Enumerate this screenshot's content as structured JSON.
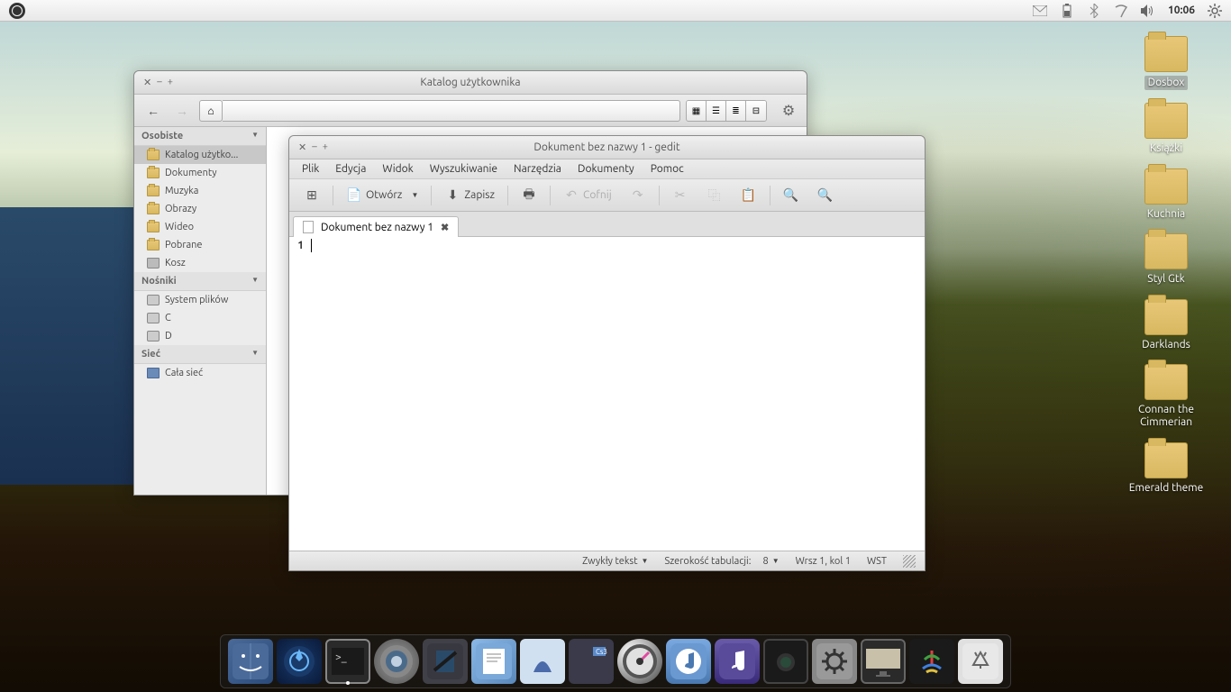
{
  "panel": {
    "time": "10:06"
  },
  "desktop_folders": [
    {
      "label": "Dosbox",
      "selected": true
    },
    {
      "label": "Książki",
      "selected": false
    },
    {
      "label": "Kuchnia",
      "selected": false
    },
    {
      "label": "Styl Gtk",
      "selected": false
    },
    {
      "label": "Darklands",
      "selected": false
    },
    {
      "label": "Connan the Cimmerian",
      "selected": false
    },
    {
      "label": "Emerald theme",
      "selected": false
    }
  ],
  "file_manager": {
    "title": "Katalog użytkownika",
    "sidebar": {
      "personal_header": "Osobiste",
      "personal": [
        {
          "label": "Katalog użytko...",
          "selected": true
        },
        {
          "label": "Dokumenty",
          "selected": false
        },
        {
          "label": "Muzyka",
          "selected": false
        },
        {
          "label": "Obrazy",
          "selected": false
        },
        {
          "label": "Wideo",
          "selected": false
        },
        {
          "label": "Pobrane",
          "selected": false
        },
        {
          "label": "Kosz",
          "selected": false,
          "icon": "trash"
        }
      ],
      "media_header": "Nośniki",
      "media": [
        {
          "label": "System plików",
          "icon": "disk"
        },
        {
          "label": "C",
          "icon": "disk"
        },
        {
          "label": "D",
          "icon": "disk"
        }
      ],
      "network_header": "Sieć",
      "network": [
        {
          "label": "Cała sieć",
          "icon": "net"
        }
      ]
    }
  },
  "gedit": {
    "title": "Dokument bez nazwy 1 - gedit",
    "menu": [
      "Plik",
      "Edycja",
      "Widok",
      "Wyszukiwanie",
      "Narzędzia",
      "Dokumenty",
      "Pomoc"
    ],
    "toolbar": {
      "open": "Otwórz",
      "save": "Zapisz",
      "undo": "Cofnij"
    },
    "tab": "Dokument bez nazwy 1",
    "line_number": "1",
    "status": {
      "syntax": "Zwykły tekst",
      "tab_label": "Szerokość tabulacji:",
      "tab_width": "8",
      "position": "Wrsz 1, kol 1",
      "insert": "WST"
    }
  }
}
